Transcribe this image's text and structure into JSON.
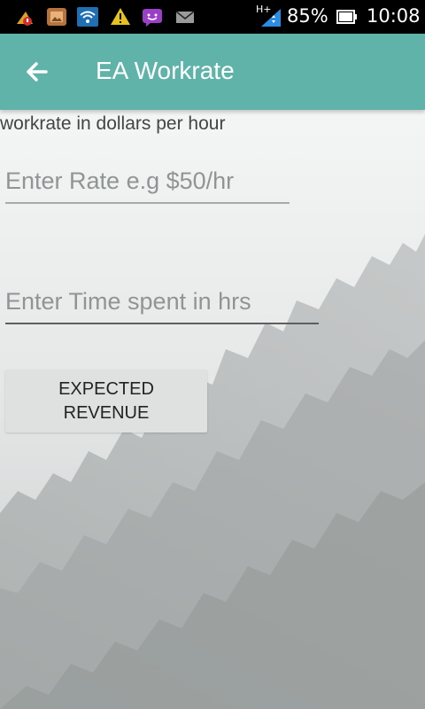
{
  "status_bar": {
    "icons": [
      "notification-alert-icon",
      "gallery-icon",
      "wifi-icon",
      "warning-icon",
      "messaging-icon",
      "email-icon",
      "signal-icon",
      "battery-icon"
    ],
    "network_type": "H+",
    "battery_percent": "85%",
    "time": "10:08"
  },
  "app_bar": {
    "title": "EA Workrate",
    "color": "#5fb3a8",
    "back_icon": "arrow-left-icon"
  },
  "main": {
    "description": "workrate in dollars per hour",
    "rate_field": {
      "placeholder": "Enter Rate e.g $50/hr",
      "value": ""
    },
    "time_field": {
      "placeholder": "Enter Time spent in hrs",
      "value": ""
    },
    "calc_button": {
      "line1": "EXPECTED",
      "line2": "REVENUE"
    }
  }
}
